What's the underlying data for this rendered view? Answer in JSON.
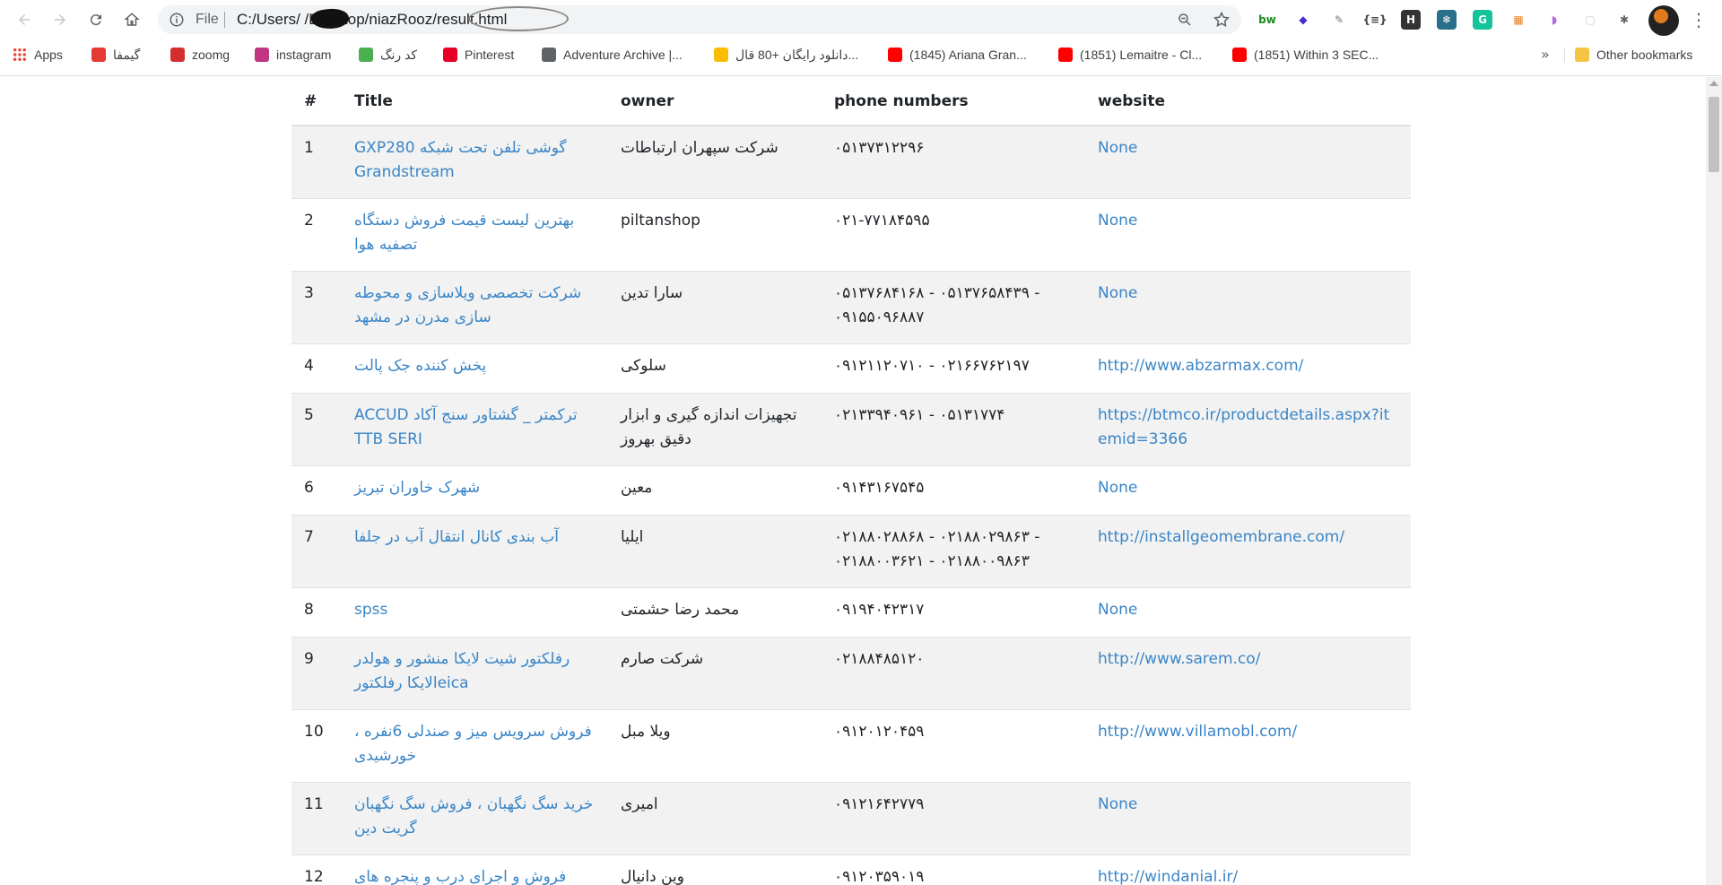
{
  "browser": {
    "file_label": "File",
    "url": "C:/Users/      /Desktop/niazRooz/result.html",
    "bookmarks": [
      {
        "label": "Apps",
        "icon": "apps-grid-icon",
        "color": "#ea4335"
      },
      {
        "label": "گیمفا",
        "icon": "gamefa-icon",
        "color": "#e53935"
      },
      {
        "label": "zoomg",
        "icon": "zoomg-icon",
        "color": "#d32f2f"
      },
      {
        "label": "instagram",
        "icon": "instagram-icon",
        "color": "#c13584"
      },
      {
        "label": "کد رنگ",
        "icon": "color-code-icon",
        "color": "#4caf50"
      },
      {
        "label": "Pinterest",
        "icon": "pinterest-icon",
        "color": "#e60023"
      },
      {
        "label": "Adventure Archive |...",
        "icon": "globe-icon",
        "color": "#5f6368"
      },
      {
        "label": "دانلود رایگان +80 قال...",
        "icon": "drive-icon",
        "color": "#fbbc04"
      },
      {
        "label": "(1845) Ariana Gran...",
        "icon": "youtube-icon",
        "color": "#ff0000"
      },
      {
        "label": "(1851) Lemaitre - Cl...",
        "icon": "youtube-icon",
        "color": "#ff0000"
      },
      {
        "label": "(1851) Within 3 SEC...",
        "icon": "youtube-icon",
        "color": "#ff0000"
      }
    ],
    "more_label": "»",
    "other_bookmarks": "Other bookmarks",
    "extensions": [
      {
        "label": "bw",
        "bg": "#ffffff",
        "fg": "#1b8a1b"
      },
      {
        "label": "◆",
        "bg": "#ffffff",
        "fg": "#4b2ccf"
      },
      {
        "label": "✎",
        "bg": "#ffffff",
        "fg": "#777777"
      },
      {
        "label": "{≡}",
        "bg": "#ffffff",
        "fg": "#444444"
      },
      {
        "label": "H",
        "bg": "#333333",
        "fg": "#ffffff"
      },
      {
        "label": "❄",
        "bg": "#2a6f8a",
        "fg": "#ffffff"
      },
      {
        "label": "G",
        "bg": "#15c39a",
        "fg": "#ffffff"
      },
      {
        "label": "▦",
        "bg": "#ffffff",
        "fg": "#e67e22"
      },
      {
        "label": "◗",
        "bg": "#ffffff",
        "fg": "#b36be0"
      },
      {
        "label": "▢",
        "bg": "#ffffff",
        "fg": "#cccccc"
      },
      {
        "label": "✱",
        "bg": "#ffffff",
        "fg": "#5f6368"
      }
    ]
  },
  "table": {
    "headers": [
      "#",
      "Title",
      "owner",
      "phone numbers",
      "website"
    ],
    "rows": [
      {
        "num": "1",
        "title": "گوشی تلفن تحت شبکه GXP280 Grandstream",
        "owner": "شرکت سپهران ارتباطات",
        "phones": "۰۵۱۳۷۳۱۲۲۹۶",
        "website": "None"
      },
      {
        "num": "2",
        "title": "بهترین لیست قیمت فروش دستگاه تصفیه هوا",
        "owner": "piltanshop",
        "phones": "۰۲۱-۷۷۱۸۴۵۹۵",
        "website": "None"
      },
      {
        "num": "3",
        "title": "شرکت تخصصی ویلاسازی و محوطه سازی مدرن در مشهد",
        "owner": "سارا تدین",
        "phones": "۰۵۱۳۷۶۸۴۱۶۸ - ۰۵۱۳۷۶۵۸۴۳۹ - ۰۹۱۵۵۰۹۶۸۸۷",
        "website": "None"
      },
      {
        "num": "4",
        "title": "پخش کننده جک پالت",
        "owner": "سلوکی",
        "phones": "۰۹۱۲۱۱۲۰۷۱۰ - ۰۲۱۶۶۷۶۲۱۹۷",
        "website": "http://www.abzarmax.com/"
      },
      {
        "num": "5",
        "title": "ترکمتر _ گشتاور سنج آکاد ACCUD TTB SERI",
        "owner": "تجهیزات اندازه گیری و ابزار دقیق بهروز",
        "phones": "۰۲۱۳۳۹۴۰۹۶۱ - ۰۵۱۳۱۷۷۴",
        "website": "https://btmco.ir/productdetails.aspx?itemid=3366"
      },
      {
        "num": "6",
        "title": "شهرک خاوران تبریز",
        "owner": "معین",
        "phones": "۰۹۱۴۳۱۶۷۵۴۵",
        "website": "None"
      },
      {
        "num": "7",
        "title": "آب بندی کانال انتقال آب در جلفا",
        "owner": "ایلیا",
        "phones": "۰۲۱۸۸۰۲۸۸۶۸ - ۰۲۱۸۸۰۲۹۸۶۳ - ۰۲۱۸۸۰۰۳۶۲۱ - ۰۲۱۸۸۰۰۹۸۶۳",
        "website": "http://installgeomembrane.com/"
      },
      {
        "num": "8",
        "title": "spss",
        "owner": "محمد رضا حشمتی",
        "phones": "۰۹۱۹۴۰۴۲۳۱۷",
        "website": "None"
      },
      {
        "num": "9",
        "title": "رفلکتور شیت لایکا منشور و هولدر leicaلایکا رفلکتور",
        "owner": "شرکت صارم",
        "phones": "۰۲۱۸۸۴۸۵۱۲۰",
        "website": "http://www.sarem.co/"
      },
      {
        "num": "10",
        "title": "فروش سرویس میز و صندلی 6نفره ، خورشیدی",
        "owner": "ویلا مبل",
        "phones": "۰۹۱۲۰۱۲۰۴۵۹",
        "website": "http://www.villamobl.com/"
      },
      {
        "num": "11",
        "title": "خرید سگ نگهبان ، فروش سگ نگهبان گریت دین",
        "owner": "امیری",
        "phones": "۰۹۱۲۱۶۴۲۷۷۹",
        "website": "None"
      },
      {
        "num": "12",
        "title": "فروش و اجرای درب و پنجره های",
        "owner": "وین دانیال",
        "phones": "۰۹۱۲۰۳۵۹۰۱۹",
        "website": "http://windanial.ir/"
      }
    ]
  }
}
